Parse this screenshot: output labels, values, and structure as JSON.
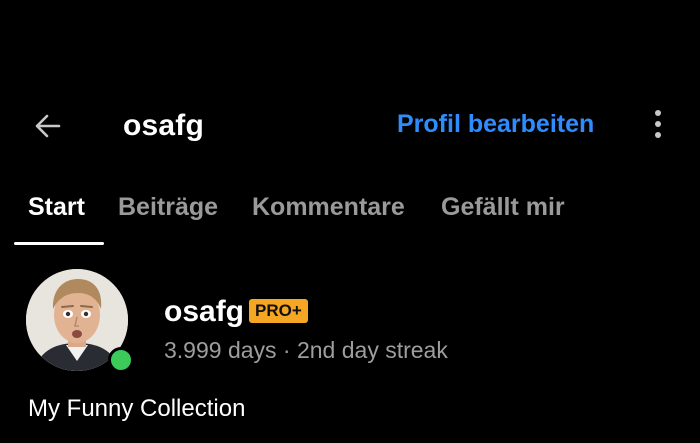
{
  "header": {
    "back_icon": "arrow-left-icon",
    "title": "osafg",
    "edit_profile_label": "Profil bearbeiten",
    "more_icon": "more-vertical-icon"
  },
  "tabs": [
    {
      "label": "Start",
      "active": true
    },
    {
      "label": "Beiträge",
      "active": false
    },
    {
      "label": "Kommentare",
      "active": false
    },
    {
      "label": "Gefällt mir",
      "active": false
    }
  ],
  "profile": {
    "avatar_icon": "user-avatar-photo",
    "online": true,
    "username": "osafg",
    "badge": "PRO+",
    "meta": "3.999 days · 2nd day streak",
    "bio": "My Funny Collection"
  },
  "colors": {
    "background": "#000000",
    "accent": "#2e8cff",
    "badge": "#f5a623",
    "online": "#3ccb5a",
    "muted_text": "#9a9a9a"
  }
}
